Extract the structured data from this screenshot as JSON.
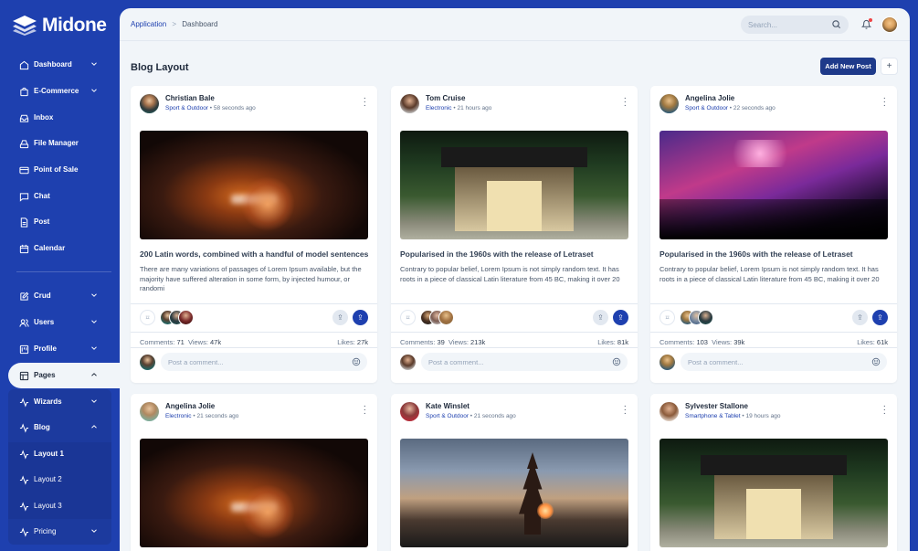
{
  "app": {
    "name": "Midone"
  },
  "sidebar": {
    "items": [
      {
        "label": "Dashboard",
        "icon": "home-icon"
      },
      {
        "label": "E-Commerce",
        "icon": "shopping-bag-icon"
      },
      {
        "label": "Inbox",
        "icon": "inbox-icon"
      },
      {
        "label": "File Manager",
        "icon": "hard-drive-icon"
      },
      {
        "label": "Point of Sale",
        "icon": "credit-card-icon"
      },
      {
        "label": "Chat",
        "icon": "message-square-icon"
      },
      {
        "label": "Post",
        "icon": "file-text-icon"
      },
      {
        "label": "Calendar",
        "icon": "calendar-icon"
      },
      {
        "label": "Crud",
        "icon": "edit-icon"
      },
      {
        "label": "Users",
        "icon": "users-icon"
      },
      {
        "label": "Profile",
        "icon": "trello-icon"
      },
      {
        "label": "Pages",
        "icon": "layout-icon"
      },
      {
        "label": "Wizards",
        "icon": "activity-icon"
      },
      {
        "label": "Blog",
        "icon": "activity-icon"
      },
      {
        "label": "Layout 1",
        "icon": "zap-icon"
      },
      {
        "label": "Layout 2",
        "icon": "zap-icon"
      },
      {
        "label": "Layout 3",
        "icon": "zap-icon"
      },
      {
        "label": "Pricing",
        "icon": "activity-icon"
      }
    ]
  },
  "topbar": {
    "breadcrumb": {
      "root": "Application",
      "separator": ">",
      "current": "Dashboard"
    },
    "search_placeholder": "Search..."
  },
  "page": {
    "title": "Blog Layout",
    "add_button": "Add New Post",
    "plus_button": "+"
  },
  "comment_placeholder": "Post a comment...",
  "labels": {
    "comments": "Comments:",
    "views": "Views:",
    "likes": "Likes:",
    "dot": "•"
  },
  "posts": [
    {
      "author": "Christian Bale",
      "category": "Sport & Outdoor",
      "time": "58 seconds ago",
      "title": "200 Latin words, combined with a handful of model sentences",
      "body": "There are many variations of passages of Lorem Ipsum available, but the majority have suffered alteration in some form, by injected humour, or randomi",
      "comments": "71",
      "views": "47k",
      "likes": "27k"
    },
    {
      "author": "Tom Cruise",
      "category": "Electronic",
      "time": "21 hours ago",
      "title": "Popularised in the 1960s with the release of Letraset",
      "body": "Contrary to popular belief, Lorem Ipsum is not simply random text. It has roots in a piece of classical Latin literature from 45 BC, making it over 20",
      "comments": "39",
      "views": "213k",
      "likes": "81k"
    },
    {
      "author": "Angelina Jolie",
      "category": "Sport & Outdoor",
      "time": "22 seconds ago",
      "title": "Popularised in the 1960s with the release of Letraset",
      "body": "Contrary to popular belief, Lorem Ipsum is not simply random text. It has roots in a piece of classical Latin literature from 45 BC, making it over 20",
      "comments": "103",
      "views": "39k",
      "likes": "61k"
    },
    {
      "author": "Angelina Jolie",
      "category": "Electronic",
      "time": "21 seconds ago"
    },
    {
      "author": "Kate Winslet",
      "category": "Sport & Outdoor",
      "time": "21 seconds ago"
    },
    {
      "author": "Sylvester Stallone",
      "category": "Smartphone & Tablet",
      "time": "19 hours ago"
    }
  ],
  "colors": {
    "primary": "#1e40af",
    "dark": "#1e3a8a",
    "bg": "#f1f5f9"
  }
}
